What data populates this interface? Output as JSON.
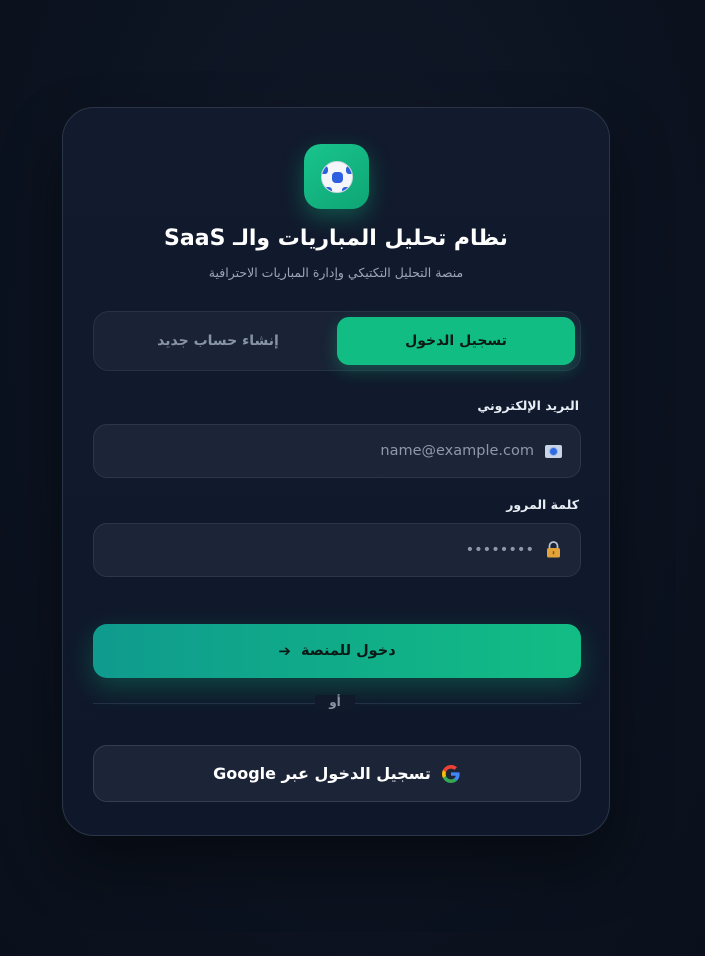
{
  "header": {
    "title": "نظام تحليل المباريات والـ SaaS",
    "subtitle": "منصة التحليل التكتيكي وإدارة المباريات الاحترافية"
  },
  "tabs": {
    "login_label": "تسجيل الدخول",
    "register_label": "إنشاء حساب جديد",
    "active": "login"
  },
  "form": {
    "email_label": "البريد الإلكتروني",
    "email_placeholder": "name@example.com",
    "password_label": "كلمة المرور",
    "password_placeholder": "••••••••",
    "submit_label": "دخول للمنصة",
    "submit_arrow": "➔"
  },
  "divider_text": "أو",
  "google_label": "تسجيل الدخول عبر Google",
  "icons": {
    "logo": "soccer-ball-icon",
    "email": "mail-icon",
    "password": "lock-icon",
    "google": "google-icon"
  },
  "colors": {
    "accent": "#12bd84",
    "background": "#0d1422",
    "card": "#111b2d"
  }
}
